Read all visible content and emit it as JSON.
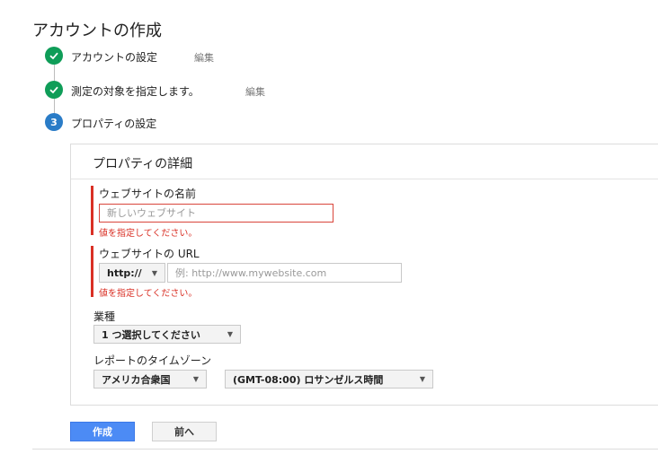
{
  "page": {
    "title": "アカウントの作成"
  },
  "steps": [
    {
      "label": "アカウントの設定",
      "edit_label": "編集"
    },
    {
      "label": "測定の対象を指定します。",
      "edit_label": "編集"
    },
    {
      "number": "3",
      "label": "プロパティの設定"
    }
  ],
  "panel": {
    "title": "プロパティの詳細",
    "website_name": {
      "label": "ウェブサイトの名前",
      "value": "",
      "placeholder": "新しいウェブサイト",
      "error": "値を指定してください。"
    },
    "website_url": {
      "label": "ウェブサイトの URL",
      "protocol": "http://",
      "value": "",
      "placeholder": "例: http://www.mywebsite.com",
      "error": "値を指定してください。"
    },
    "industry": {
      "label": "業種",
      "selected": "1 つ選択してください"
    },
    "timezone": {
      "label": "レポートのタイムゾーン",
      "country": "アメリカ合衆国",
      "zone": "(GMT-08:00) ロサンゼルス時間"
    }
  },
  "actions": {
    "create_label": "作成",
    "back_label": "前へ"
  },
  "colors": {
    "success": "#0f9d58",
    "active_step": "#2a7cc7",
    "error": "#d93025",
    "primary": "#4c8bf5"
  },
  "icons": {
    "done": "checkmark-icon",
    "dropdown": "caret-down-icon"
  }
}
